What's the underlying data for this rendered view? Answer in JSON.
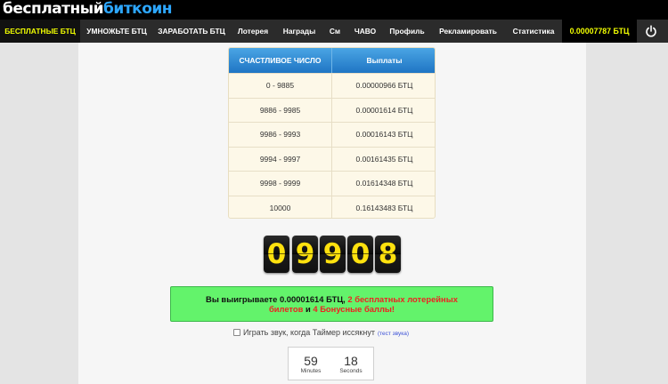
{
  "header": {
    "logo_part1": "бесплатный",
    "logo_part2": "биткоин",
    "colors": {
      "accent_yellow": "#f2ff00",
      "logo_blue": "#2da7ff",
      "nav_bg": "#2b2b2b"
    }
  },
  "nav": {
    "items": [
      "БЕСПЛАТНЫЕ БТЦ",
      "УМНОЖЬТЕ БТЦ",
      "ЗАРАБОТАТЬ БТЦ",
      "Лотерея",
      "Награды",
      "См",
      "ЧАВО",
      "Профиль",
      "Рекламировать",
      "Статистика"
    ],
    "balance": "0.00007787 БТЦ",
    "power_icon": "power-icon"
  },
  "prize_table": {
    "headers": [
      "СЧАСТЛИВОЕ ЧИСЛО",
      "Выплаты"
    ],
    "rows": [
      [
        "0 - 9885",
        "0.00000966 БТЦ"
      ],
      [
        "9886 - 9985",
        "0.00001614 БТЦ"
      ],
      [
        "9986 - 9993",
        "0.00016143 БТЦ"
      ],
      [
        "9994 - 9997",
        "0.00161435 БТЦ"
      ],
      [
        "9998 - 9999",
        "0.01614348 БТЦ"
      ],
      [
        "10000",
        "0.16143483 БТЦ"
      ]
    ]
  },
  "roll": {
    "digits": [
      "0",
      "9",
      "9",
      "0",
      "8"
    ]
  },
  "result": {
    "prefix": "Вы выигрываете 0.00001614 БТЦ,",
    "tickets": "2 бесплатных лотерейных билетов",
    "joiner": "и",
    "bonus": "4 Бонусные баллы!",
    "colors": {
      "box": "#63f36b",
      "highlight": "#e22222"
    }
  },
  "sound": {
    "label": "Играть звук, когда Таймер иссякнут",
    "test_link": "(тест звука)"
  },
  "timer": {
    "minutes": "59",
    "minutes_label": "Minutes",
    "seconds": "18",
    "seconds_label": "Seconds"
  }
}
